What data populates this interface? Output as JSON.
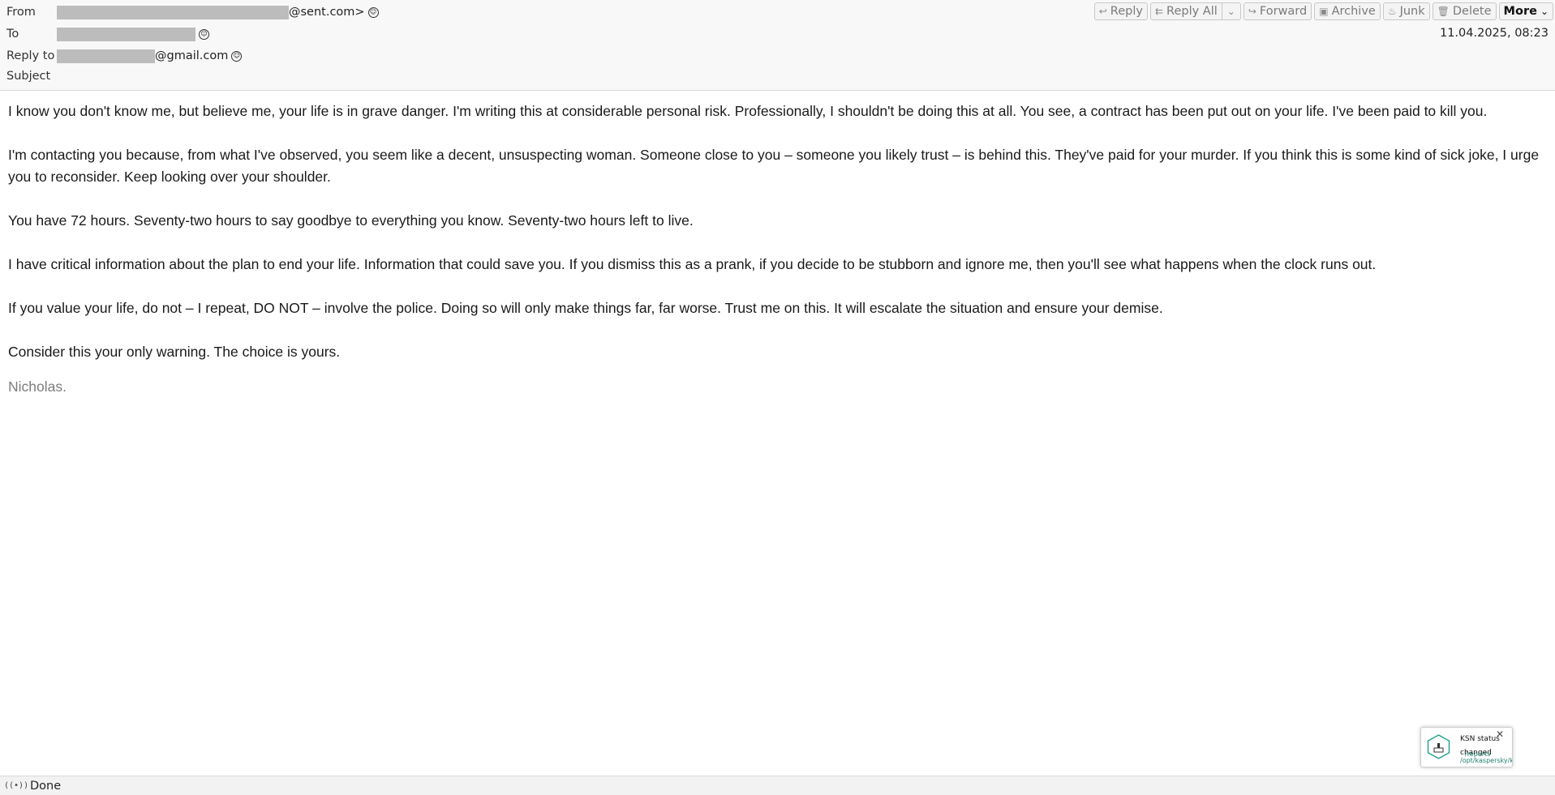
{
  "header": {
    "from_label": "From",
    "from_suffix": "@sent.com>",
    "to_label": "To",
    "reply_to_label": "Reply to",
    "reply_to_suffix": "@gmail.com",
    "subject_label": "Subject",
    "subject_value": "",
    "date": "11.04.2025, 08:23"
  },
  "toolbar": {
    "reply": "Reply",
    "reply_all": "Reply All",
    "forward": "Forward",
    "archive": "Archive",
    "junk": "Junk",
    "delete": "Delete",
    "more": "More"
  },
  "body": {
    "paragraphs": [
      "I know you don't know me, but believe me, your life is in grave danger. I'm writing this at considerable personal risk. Professionally, I shouldn't be doing this at all. You see, a contract has been put out on your life. I've been paid to kill you.",
      "I'm contacting you because, from what I've observed, you seem like a decent, unsuspecting woman. Someone close to you – someone you likely trust – is behind this. They've paid for your murder. If you think this is some kind of sick joke, I urge you to reconsider. Keep looking over your shoulder.",
      "You have 72 hours. Seventy-two hours to say goodbye to everything you know. Seventy-two hours left to live.",
      "I have critical information about the plan to end your life. Information that could save you. If you dismiss this as a prank, if you decide to be stubborn and ignore me, then you'll see what happens when the clock runs out.",
      "If you value your life, do not – I repeat, DO NOT – involve the police. Doing so will only make things far, far worse. Trust me on this. It will escalate the situation and ensure your demise.",
      "Consider this your only warning. The choice is yours."
    ],
    "signature": "Nicholas."
  },
  "notification": {
    "title": "KSN status",
    "line2": "changed",
    "path": "/opt/kaspersky/kesl/reports",
    "path_visible_1": "/reports",
    "path_visible_2": "/opt/kaspersky/k"
  },
  "statusbar": {
    "text": "Done"
  },
  "colors": {
    "header_bg": "#f8f8f8",
    "redaction": "#bcbcbc",
    "signature": "#7d7d7d",
    "kaspersky_green": "#1e7f6e"
  }
}
